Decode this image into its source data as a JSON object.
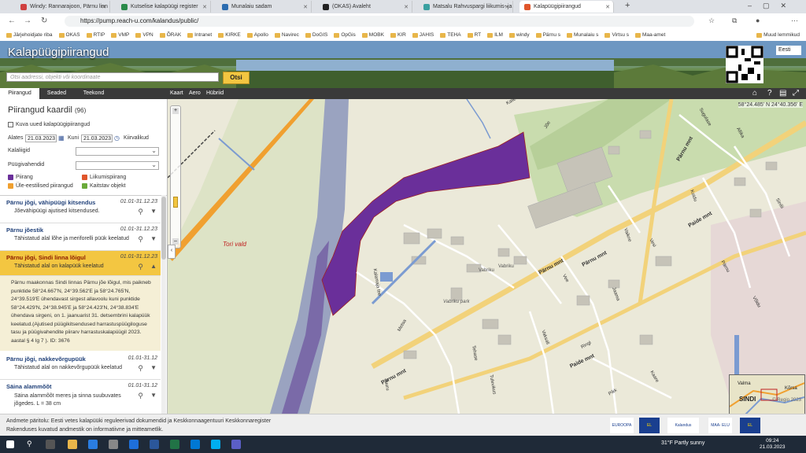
{
  "browser": {
    "tabs": [
      {
        "label": "Windy: Rannarajoon, Pärnu linn",
        "color": "#d04040"
      },
      {
        "label": "Kutselise kalapüügi register",
        "color": "#2a8a4a"
      },
      {
        "label": "Munalaiu sadam",
        "color": "#2b6cb0"
      },
      {
        "label": "(OKAS) Avaleht",
        "color": "#222222"
      },
      {
        "label": "Matsalu Rahvuspargi liikumis- ja",
        "color": "#3aa0a0"
      },
      {
        "label": "Kalapüügipiirangud",
        "color": "#e0552b"
      }
    ],
    "url": "https://pump.reach-u.com/kalandus/public/",
    "bookmarks": [
      "Järjehoidjate riba",
      "OKAS",
      "RTIP",
      "VMP",
      "VPN",
      "ÕRAK",
      "Intranet",
      "KIRKE",
      "Apollo",
      "Navirec",
      "DoGIS",
      "OpGis",
      "MOBK",
      "KIR",
      "JAHIS",
      "TEHA",
      "RT",
      "ILM",
      "windy",
      "Pärnu s",
      "Munalaiu s",
      "Virtsu s",
      "Maa-amet"
    ],
    "bookmarks_other": "Muud lemmikud"
  },
  "header": {
    "title": "Kalapüügipiirangud",
    "search_placeholder": "Otsi aadressi, objekti või koordinaate",
    "search_button": "Otsi",
    "language": "Eesti"
  },
  "panel_tabs": [
    "Piirangud",
    "Seaded",
    "Teekond"
  ],
  "map_tabs": [
    "Kaart",
    "Aero",
    "Hübriid"
  ],
  "panel": {
    "title": "Piirangud kaardil",
    "count": "(96)",
    "show_new_label": "Kuva uued kalapüügipiirangud",
    "from_label": "Alates",
    "from_date": "21.03.2023",
    "to_label": "Kuni",
    "to_date": "21.03.2023",
    "clock_label": "Kiirvalikud",
    "species_label": "Kalaliigid",
    "gear_label": "Püügivahendid",
    "legend": [
      {
        "label": "Piirang",
        "color": "#6a2f9a"
      },
      {
        "label": "Liikumispiirang",
        "color": "#e0552b"
      },
      {
        "label": "Üle-eestilised piirangud",
        "color": "#f0a030"
      },
      {
        "label": "Kaitstav objekt",
        "color": "#6aaa3a"
      }
    ],
    "items": [
      {
        "title": "Pärnu jõgi, vähipüügi kitsendus",
        "dates": "01.01-31.12.23",
        "sub": "Jõevähipüügi ajutised kitsendused."
      },
      {
        "title": "Pärnu jõestik",
        "dates": "01.01-31.12.23",
        "sub": "Tähistatud alal lõhe ja meriforelli püük keelatud"
      },
      {
        "title": "Pärnu jõgi, Sindi linna lõigul",
        "dates": "01.01-31.12.23",
        "sub": "Tähistatud alal on kalapüük keelatud"
      },
      {
        "title": "Pärnu jõgi, nakkevõrgupüük",
        "dates": "01.01-31.12",
        "sub": "Tähistatud alal on nakkevõrgupüük keelatud"
      },
      {
        "title": "Säina alammõõt",
        "dates": "01.01-31.12",
        "sub": "Säina alammõõt meres ja sinna suubuvates jõgedes. L = 38 cm"
      }
    ],
    "detail": "Pärnu maakonnas Sindi linnas Pärnu jõe lõigul, mis paikneb punktide 58°24.667'N, 24°39.562'E ja 58°24.765'N, 24°39.519'E ühendavast sirgest allavoolu kuni punktide 58°24.429'N, 24°38.945'E ja 58°24.423'N, 24°38.834'E ühendava sirgeni, on 1. jaanuarist 31. detsembrini kalapüük keelatud.(Ajutised püügikitsendused harrastuspüügiloguse tasu ja püügivahendite piirarv harrastuskalapüügil 2023. aastal § 4 lg 7 ). ID: 3676"
  },
  "map": {
    "coordinates": "58°24.485' N 24°40.356' E",
    "copyright": "© Regio 2023",
    "labels": [
      "Tori vald",
      "Pärnu mnt",
      "Pärnu mnt",
      "Pärnu mnt",
      "Pärnu mnt",
      "Paide mnt",
      "Paide mnt",
      "Vabriku",
      "Vabriku park",
      "Kalamaja tee",
      "Metsa",
      "Tehase",
      "Vaikne",
      "Vee",
      "Ringi",
      "Jaama",
      "Tuuru",
      "Tulevikus",
      "Vaksali",
      "Sugulase",
      "Vesi",
      "Koidu",
      "Pikk",
      "Kaare",
      "Allika",
      "Vabriku",
      "Jõe",
      "Kalle",
      "Sinilii",
      "Pärnu",
      "Võidu"
    ],
    "inset_labels": [
      "Valma",
      "Kõrsa",
      "SINDI"
    ]
  },
  "footer": {
    "line1": "Andmete päritolu: Eesti vetes kalapüüki reguleerivad dokumendid ja Keskkonnaagentuuri Keskkonnaregister",
    "line2": "Rakenduses kuvatud andmestik on informatiivne ja mitteametlik.",
    "logos": [
      "EUROOPA KALANDUSFOND",
      "EL",
      "Kalandus teabekeskus",
      "MAA- ELU",
      "EL"
    ]
  },
  "taskbar": {
    "weather": "31°F  Partly sunny",
    "time": "09:24",
    "date": "21.03.2023"
  }
}
